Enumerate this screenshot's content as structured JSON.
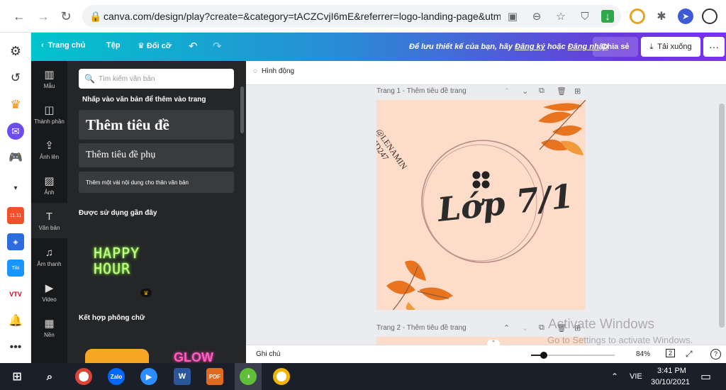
{
  "browser": {
    "url": "canva.com/design/play?create=&category=tACZCvjI6mE&referrer=logo-landing-page&utm_...",
    "nav": {
      "back": "←",
      "forward": "→",
      "reload": "↻"
    }
  },
  "canva_header": {
    "home": "Trang chủ",
    "file": "Tệp",
    "resize": "Đổi cỡ",
    "save_prompt": "Để lưu thiết kế của bạn, hãy",
    "signup": "Đăng ký",
    "or": "hoặc",
    "login": "Đăng nhập",
    "share": "Chia sẻ",
    "download": "Tải xuống",
    "more": "···"
  },
  "tool_rail": [
    {
      "icon": "▥",
      "label": "Mẫu"
    },
    {
      "icon": "◫",
      "label": "Thành phần"
    },
    {
      "icon": "⇪",
      "label": "Ảnh lên"
    },
    {
      "icon": "▨",
      "label": "Ảnh"
    },
    {
      "icon": "T",
      "label": "Văn bản"
    },
    {
      "icon": "♫",
      "label": "Âm thanh"
    },
    {
      "icon": "▶",
      "label": "Video"
    },
    {
      "icon": "▦",
      "label": "Nền"
    }
  ],
  "text_panel": {
    "search_placeholder": "Tìm kiếm văn bản",
    "caption": "Nhấp vào văn bản để thêm vào trang",
    "heading": "Thêm tiêu đề",
    "subheading": "Thêm tiêu đề phụ",
    "body": "Thêm một vài nội dung cho thân văn bản",
    "recent_title": "Được sử dụng gần đây",
    "happy_line1": "HAPPY",
    "happy_line2": "HOUR",
    "combo_title": "Kết hợp phông chữ",
    "combo_b": "GLOW"
  },
  "workspace": {
    "animate": "Hình động",
    "page1_label": "Trang 1 - Thêm tiêu đề trang",
    "page2_label": "Trang 2 - Thêm tiêu đề trang",
    "notes": "Ghi chú",
    "zoom_value": "84%",
    "zoom_fraction": 0.15,
    "page_count": "2",
    "help": "?"
  },
  "design": {
    "handle_line1": "@LENAMIN",
    "handle_line2": "#HD247",
    "title": "Lớp 7/1",
    "background": "#fddcca",
    "leaf_color": "#e8741f"
  },
  "watermark": {
    "line1": "Activate Windows",
    "line2": "Go to Settings to activate Windows."
  },
  "taskbar": {
    "language": "VIE",
    "time": "3:41 PM",
    "date": "30/10/2021"
  }
}
